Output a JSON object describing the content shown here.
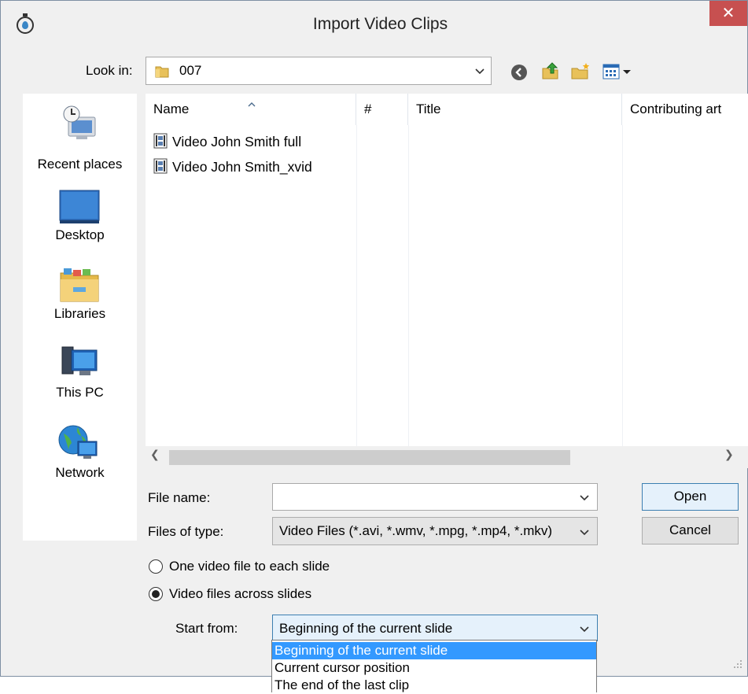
{
  "window": {
    "title": "Import Video Clips",
    "close_symbol": "✕"
  },
  "toolbar": {
    "look_in_label": "Look in:",
    "look_in_value": "007"
  },
  "places": [
    {
      "label": "Recent places",
      "icon": "recent-places-icon"
    },
    {
      "label": "Desktop",
      "icon": "desktop-icon"
    },
    {
      "label": "Libraries",
      "icon": "libraries-icon"
    },
    {
      "label": "This PC",
      "icon": "this-pc-icon"
    },
    {
      "label": "Network",
      "icon": "network-icon"
    }
  ],
  "file_list": {
    "columns": [
      "Name",
      "#",
      "Title",
      "Contributing art"
    ],
    "files": [
      "Video John Smith full",
      "Video John Smith_xvid"
    ]
  },
  "form": {
    "file_name_label": "File name:",
    "file_name_value": "",
    "files_of_type_label": "Files of type:",
    "files_of_type_value": "Video Files (*.avi, *.wmv, *.mpg, *.mp4, *.mkv)",
    "open_label": "Open",
    "cancel_label": "Cancel",
    "radio_one_label": "One video file to each slide",
    "radio_across_label": "Video files across slides",
    "start_from_label": "Start from:",
    "start_from_value": "Beginning of the current slide",
    "start_from_options": [
      "Beginning of the current slide",
      "Current cursor position",
      "The end of the last clip"
    ]
  },
  "colors": {
    "selection": "#3399ff",
    "close": "#c75050",
    "default_button_border": "#3c7fb1"
  }
}
